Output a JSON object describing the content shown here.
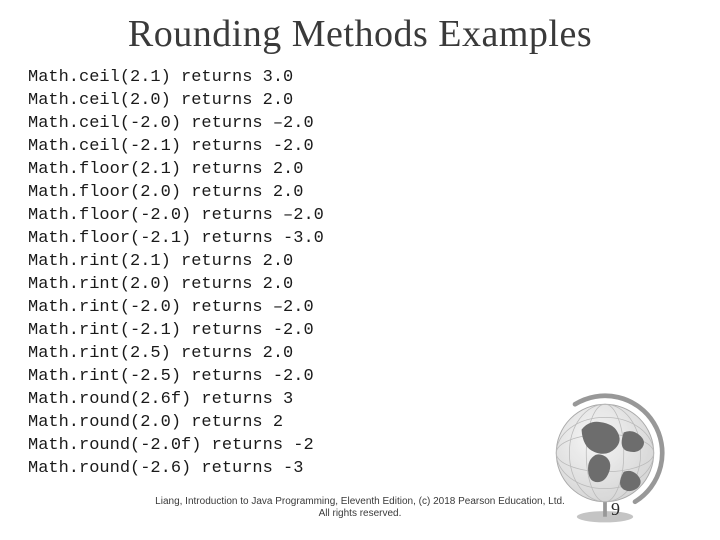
{
  "title": "Rounding Methods Examples",
  "lines": [
    "Math.ceil(2.1) returns 3.0",
    "Math.ceil(2.0) returns 2.0",
    "Math.ceil(-2.0) returns –2.0",
    "Math.ceil(-2.1) returns -2.0",
    "Math.floor(2.1) returns 2.0",
    "Math.floor(2.0) returns 2.0",
    "Math.floor(-2.0) returns –2.0",
    "Math.floor(-2.1) returns -3.0",
    "Math.rint(2.1) returns 2.0",
    "Math.rint(2.0) returns 2.0",
    "Math.rint(-2.0) returns –2.0",
    "Math.rint(-2.1) returns -2.0",
    "Math.rint(2.5) returns 2.0",
    "Math.rint(-2.5) returns -2.0",
    "Math.round(2.6f) returns 3",
    "Math.round(2.0) returns 2",
    "Math.round(-2.0f) returns -2",
    "Math.round(-2.6) returns -3"
  ],
  "footer": {
    "line1": "Liang, Introduction to Java Programming, Eleventh Edition, (c) 2018 Pearson Education, Ltd.",
    "line2": "All rights reserved."
  },
  "page_number": "9"
}
